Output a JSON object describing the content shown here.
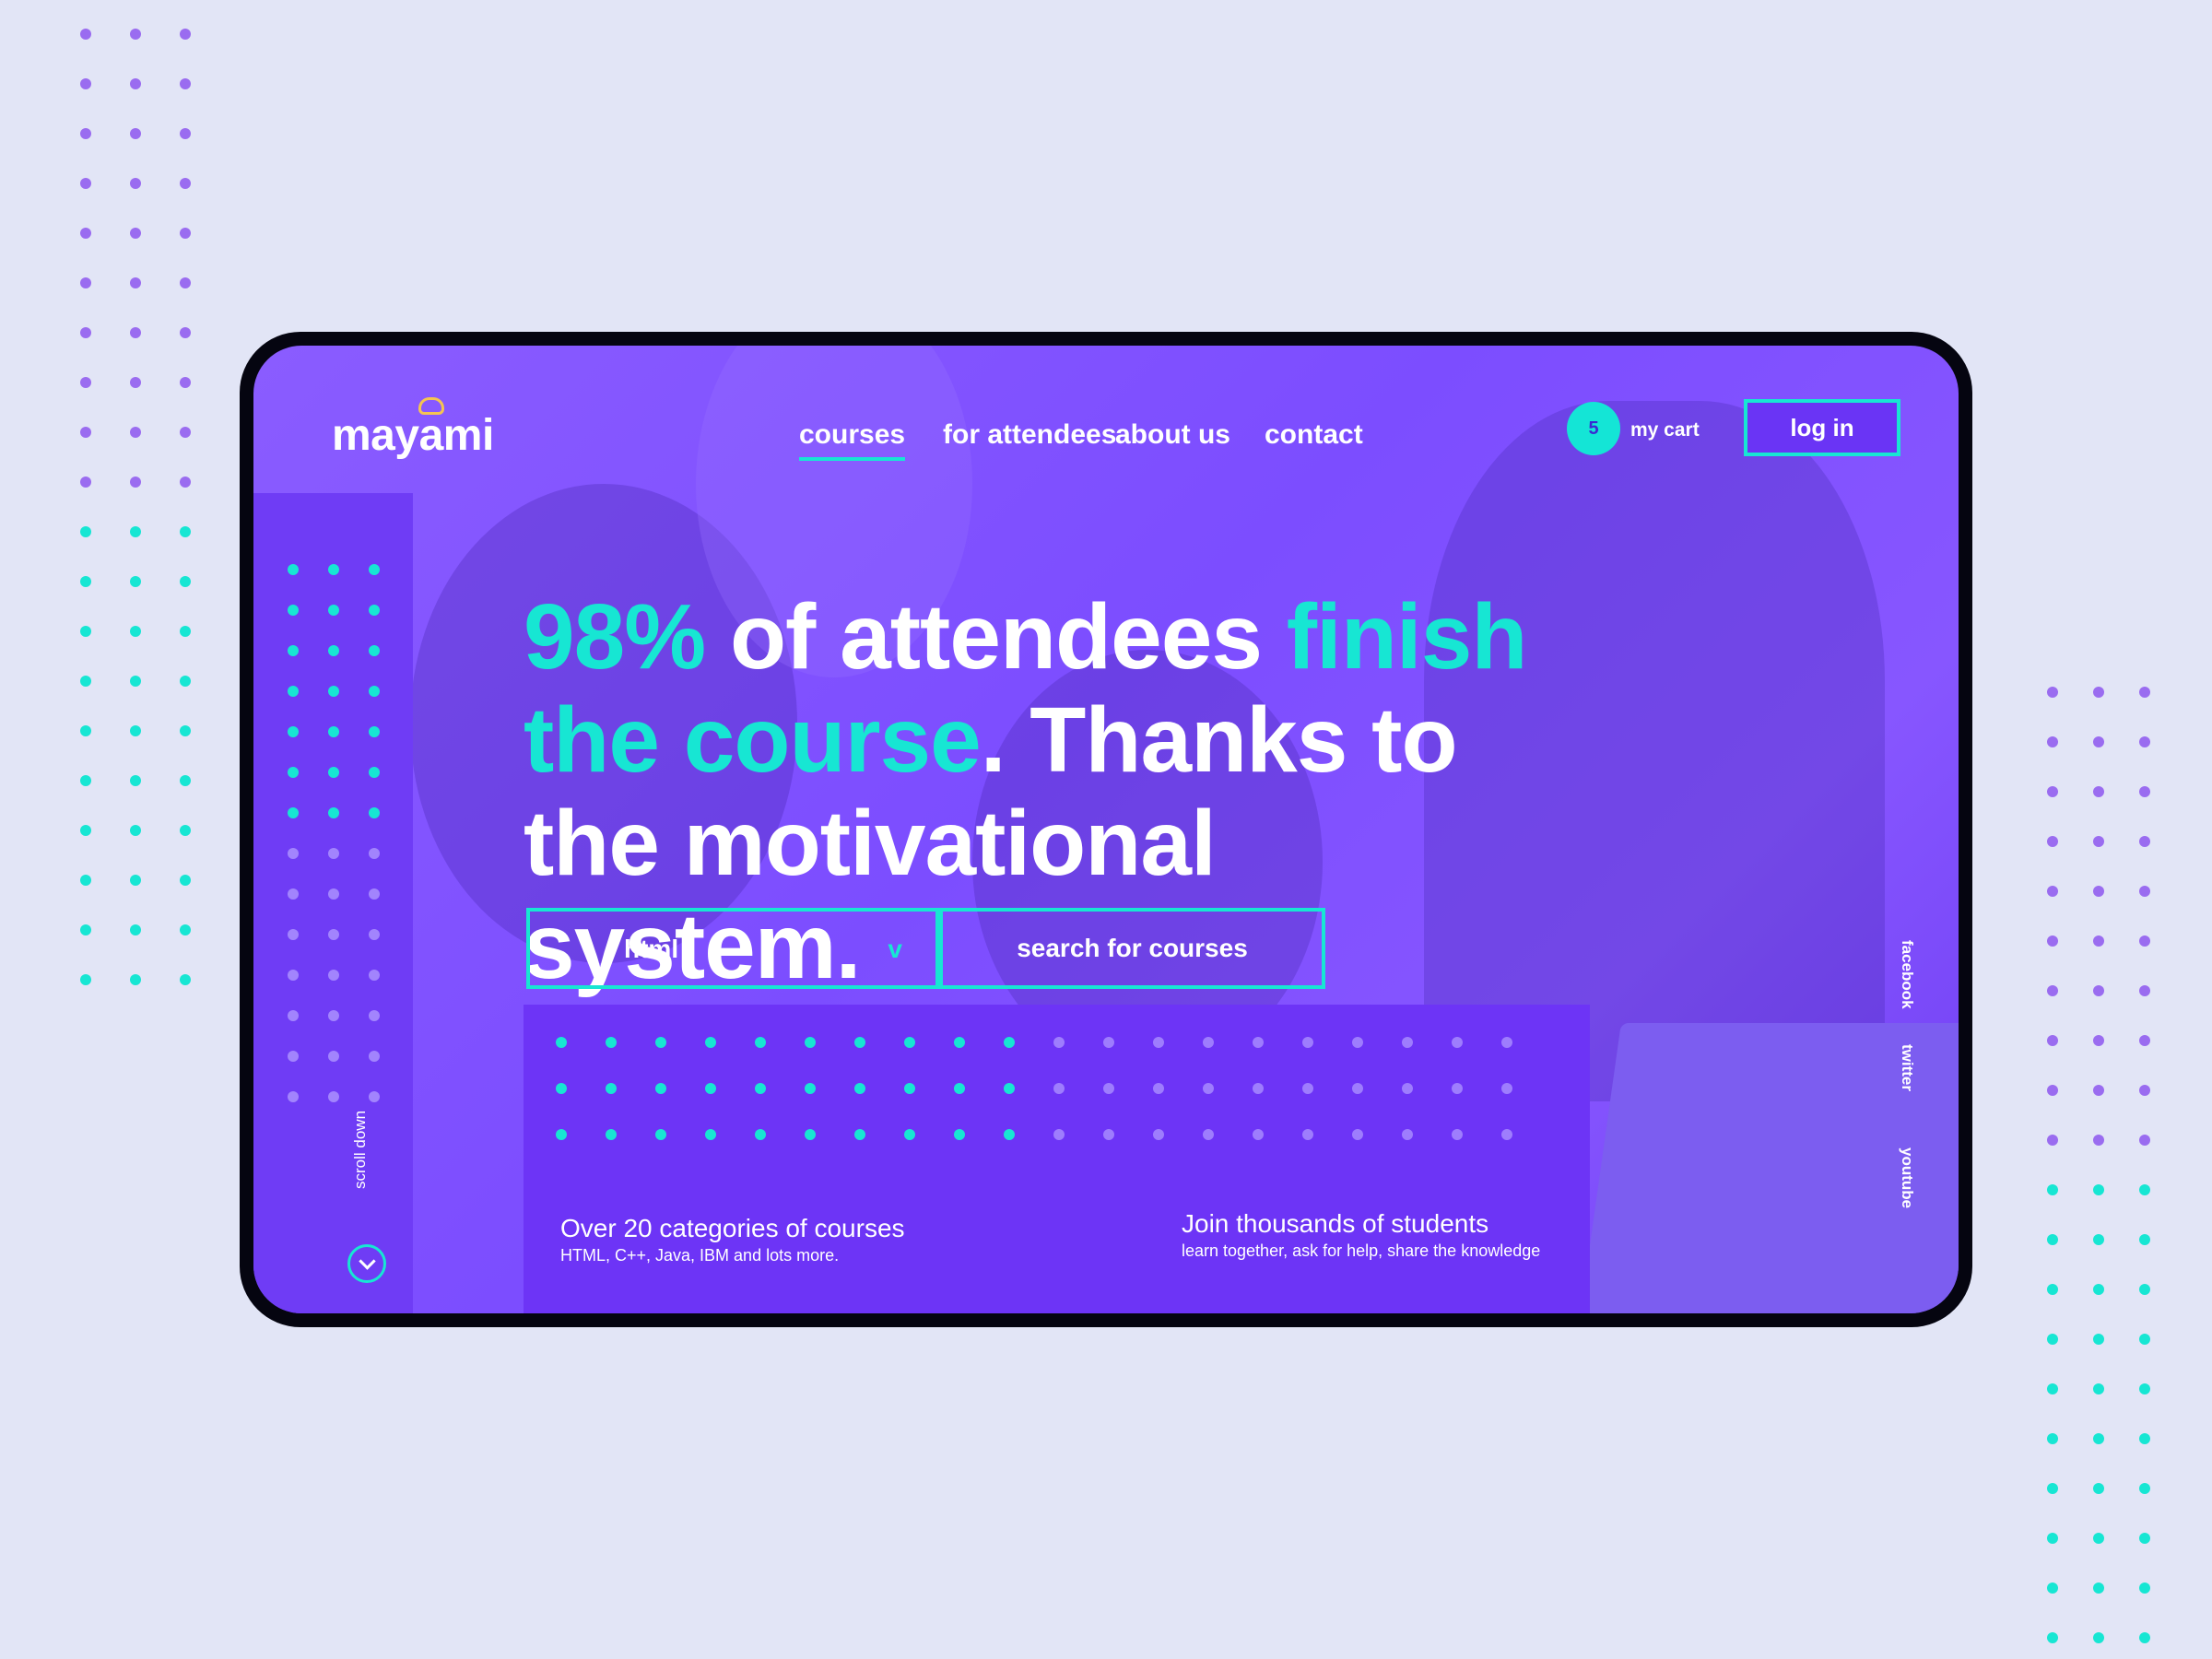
{
  "brand": {
    "name": "mayami"
  },
  "nav": {
    "items": [
      {
        "label": "courses",
        "active": true
      },
      {
        "label": "for attendees",
        "active": false
      },
      {
        "label": "about us",
        "active": false
      },
      {
        "label": "contact",
        "active": false
      }
    ],
    "cart": {
      "count": "5",
      "label": "my cart"
    },
    "login_label": "log in"
  },
  "hero": {
    "headline": {
      "percent": "98%",
      "part1": " of attendees ",
      "accent": "finish the course",
      "part2": ". Thanks to the motivational system."
    },
    "search": {
      "selected_category": "html",
      "dropdown_caret": "v",
      "button_label": "search for courses"
    }
  },
  "sidebar": {
    "scroll_label": "scroll down"
  },
  "info": [
    {
      "title": "Over 20 categories of courses",
      "subtitle": "HTML, C++, Java, IBM and lots more."
    },
    {
      "title": "Join thousands of students",
      "subtitle": "learn together, ask for help, share the knowledge"
    }
  ],
  "socials": [
    "facebook",
    "twitter",
    "youtube"
  ],
  "colors": {
    "page_bg": "#e2e5f6",
    "screen_purple": "#8a5cff",
    "panel_purple": "#6d34f6",
    "accent_teal": "#17e6d3",
    "dot_purple": "#9a6cf0"
  },
  "icons": {
    "scroll": "chevron-down-icon",
    "logo_mark": "cloud-icon"
  }
}
